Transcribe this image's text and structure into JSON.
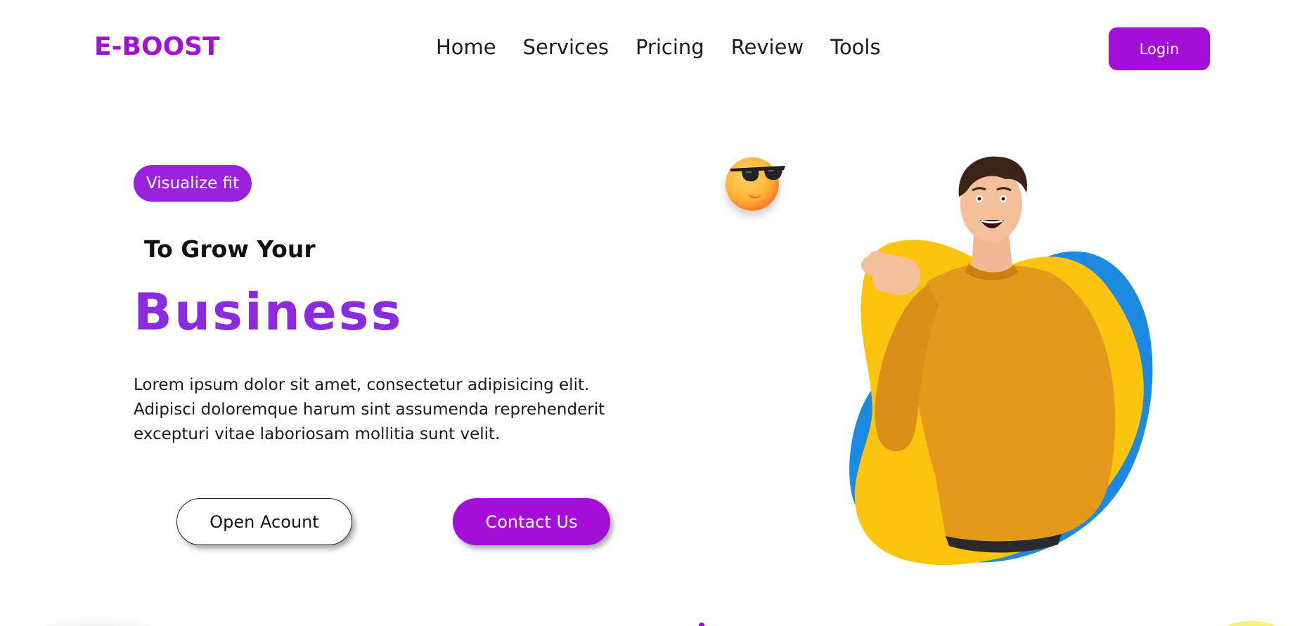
{
  "header": {
    "logo": "E-BOOST",
    "nav_items": [
      {
        "label": "Home"
      },
      {
        "label": "Services"
      },
      {
        "label": "Pricing"
      },
      {
        "label": "Review"
      },
      {
        "label": "Tools"
      }
    ],
    "login_label": "Login"
  },
  "hero": {
    "badge": "Visualize fit",
    "subheading": "To Grow Your",
    "headline": "Business",
    "description": "Lorem ipsum dolor sit amet, consectetur adipisicing elit. Adipisci doloremque harum sint assumenda reprehenderit excepturi vitae laboriosam mollitia sunt velit.",
    "open_account_label": "Open Acount",
    "contact_label": "Contact Us",
    "emoji_icon": "sunglasses-emoji-icon",
    "illustration": "smiling-man-thumbs-pointing-illustration"
  },
  "colors": {
    "brand": "#a30fd6",
    "headline": "#8a2be2",
    "blob_yellow": "#fbc40f",
    "blob_blue": "#1b8ae0",
    "sweater": "#e39a1c"
  }
}
